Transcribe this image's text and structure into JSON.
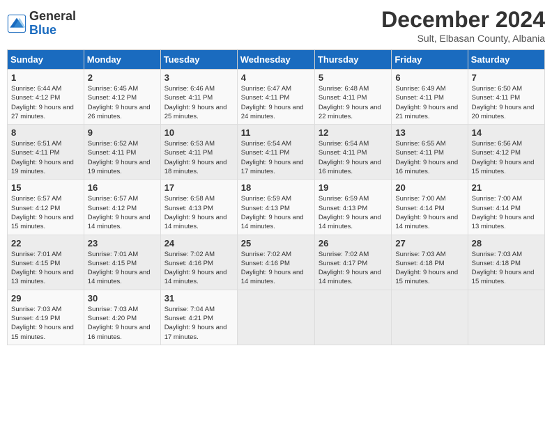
{
  "logo": {
    "general": "General",
    "blue": "Blue"
  },
  "title": "December 2024",
  "subtitle": "Sult, Elbasan County, Albania",
  "days_of_week": [
    "Sunday",
    "Monday",
    "Tuesday",
    "Wednesday",
    "Thursday",
    "Friday",
    "Saturday"
  ],
  "weeks": [
    [
      {
        "day": "1",
        "sunrise": "Sunrise: 6:44 AM",
        "sunset": "Sunset: 4:12 PM",
        "daylight": "Daylight: 9 hours and 27 minutes."
      },
      {
        "day": "2",
        "sunrise": "Sunrise: 6:45 AM",
        "sunset": "Sunset: 4:12 PM",
        "daylight": "Daylight: 9 hours and 26 minutes."
      },
      {
        "day": "3",
        "sunrise": "Sunrise: 6:46 AM",
        "sunset": "Sunset: 4:11 PM",
        "daylight": "Daylight: 9 hours and 25 minutes."
      },
      {
        "day": "4",
        "sunrise": "Sunrise: 6:47 AM",
        "sunset": "Sunset: 4:11 PM",
        "daylight": "Daylight: 9 hours and 24 minutes."
      },
      {
        "day": "5",
        "sunrise": "Sunrise: 6:48 AM",
        "sunset": "Sunset: 4:11 PM",
        "daylight": "Daylight: 9 hours and 22 minutes."
      },
      {
        "day": "6",
        "sunrise": "Sunrise: 6:49 AM",
        "sunset": "Sunset: 4:11 PM",
        "daylight": "Daylight: 9 hours and 21 minutes."
      },
      {
        "day": "7",
        "sunrise": "Sunrise: 6:50 AM",
        "sunset": "Sunset: 4:11 PM",
        "daylight": "Daylight: 9 hours and 20 minutes."
      }
    ],
    [
      {
        "day": "8",
        "sunrise": "Sunrise: 6:51 AM",
        "sunset": "Sunset: 4:11 PM",
        "daylight": "Daylight: 9 hours and 19 minutes."
      },
      {
        "day": "9",
        "sunrise": "Sunrise: 6:52 AM",
        "sunset": "Sunset: 4:11 PM",
        "daylight": "Daylight: 9 hours and 19 minutes."
      },
      {
        "day": "10",
        "sunrise": "Sunrise: 6:53 AM",
        "sunset": "Sunset: 4:11 PM",
        "daylight": "Daylight: 9 hours and 18 minutes."
      },
      {
        "day": "11",
        "sunrise": "Sunrise: 6:54 AM",
        "sunset": "Sunset: 4:11 PM",
        "daylight": "Daylight: 9 hours and 17 minutes."
      },
      {
        "day": "12",
        "sunrise": "Sunrise: 6:54 AM",
        "sunset": "Sunset: 4:11 PM",
        "daylight": "Daylight: 9 hours and 16 minutes."
      },
      {
        "day": "13",
        "sunrise": "Sunrise: 6:55 AM",
        "sunset": "Sunset: 4:11 PM",
        "daylight": "Daylight: 9 hours and 16 minutes."
      },
      {
        "day": "14",
        "sunrise": "Sunrise: 6:56 AM",
        "sunset": "Sunset: 4:12 PM",
        "daylight": "Daylight: 9 hours and 15 minutes."
      }
    ],
    [
      {
        "day": "15",
        "sunrise": "Sunrise: 6:57 AM",
        "sunset": "Sunset: 4:12 PM",
        "daylight": "Daylight: 9 hours and 15 minutes."
      },
      {
        "day": "16",
        "sunrise": "Sunrise: 6:57 AM",
        "sunset": "Sunset: 4:12 PM",
        "daylight": "Daylight: 9 hours and 14 minutes."
      },
      {
        "day": "17",
        "sunrise": "Sunrise: 6:58 AM",
        "sunset": "Sunset: 4:13 PM",
        "daylight": "Daylight: 9 hours and 14 minutes."
      },
      {
        "day": "18",
        "sunrise": "Sunrise: 6:59 AM",
        "sunset": "Sunset: 4:13 PM",
        "daylight": "Daylight: 9 hours and 14 minutes."
      },
      {
        "day": "19",
        "sunrise": "Sunrise: 6:59 AM",
        "sunset": "Sunset: 4:13 PM",
        "daylight": "Daylight: 9 hours and 14 minutes."
      },
      {
        "day": "20",
        "sunrise": "Sunrise: 7:00 AM",
        "sunset": "Sunset: 4:14 PM",
        "daylight": "Daylight: 9 hours and 14 minutes."
      },
      {
        "day": "21",
        "sunrise": "Sunrise: 7:00 AM",
        "sunset": "Sunset: 4:14 PM",
        "daylight": "Daylight: 9 hours and 13 minutes."
      }
    ],
    [
      {
        "day": "22",
        "sunrise": "Sunrise: 7:01 AM",
        "sunset": "Sunset: 4:15 PM",
        "daylight": "Daylight: 9 hours and 13 minutes."
      },
      {
        "day": "23",
        "sunrise": "Sunrise: 7:01 AM",
        "sunset": "Sunset: 4:15 PM",
        "daylight": "Daylight: 9 hours and 14 minutes."
      },
      {
        "day": "24",
        "sunrise": "Sunrise: 7:02 AM",
        "sunset": "Sunset: 4:16 PM",
        "daylight": "Daylight: 9 hours and 14 minutes."
      },
      {
        "day": "25",
        "sunrise": "Sunrise: 7:02 AM",
        "sunset": "Sunset: 4:16 PM",
        "daylight": "Daylight: 9 hours and 14 minutes."
      },
      {
        "day": "26",
        "sunrise": "Sunrise: 7:02 AM",
        "sunset": "Sunset: 4:17 PM",
        "daylight": "Daylight: 9 hours and 14 minutes."
      },
      {
        "day": "27",
        "sunrise": "Sunrise: 7:03 AM",
        "sunset": "Sunset: 4:18 PM",
        "daylight": "Daylight: 9 hours and 15 minutes."
      },
      {
        "day": "28",
        "sunrise": "Sunrise: 7:03 AM",
        "sunset": "Sunset: 4:18 PM",
        "daylight": "Daylight: 9 hours and 15 minutes."
      }
    ],
    [
      {
        "day": "29",
        "sunrise": "Sunrise: 7:03 AM",
        "sunset": "Sunset: 4:19 PM",
        "daylight": "Daylight: 9 hours and 15 minutes."
      },
      {
        "day": "30",
        "sunrise": "Sunrise: 7:03 AM",
        "sunset": "Sunset: 4:20 PM",
        "daylight": "Daylight: 9 hours and 16 minutes."
      },
      {
        "day": "31",
        "sunrise": "Sunrise: 7:04 AM",
        "sunset": "Sunset: 4:21 PM",
        "daylight": "Daylight: 9 hours and 17 minutes."
      },
      null,
      null,
      null,
      null
    ]
  ]
}
